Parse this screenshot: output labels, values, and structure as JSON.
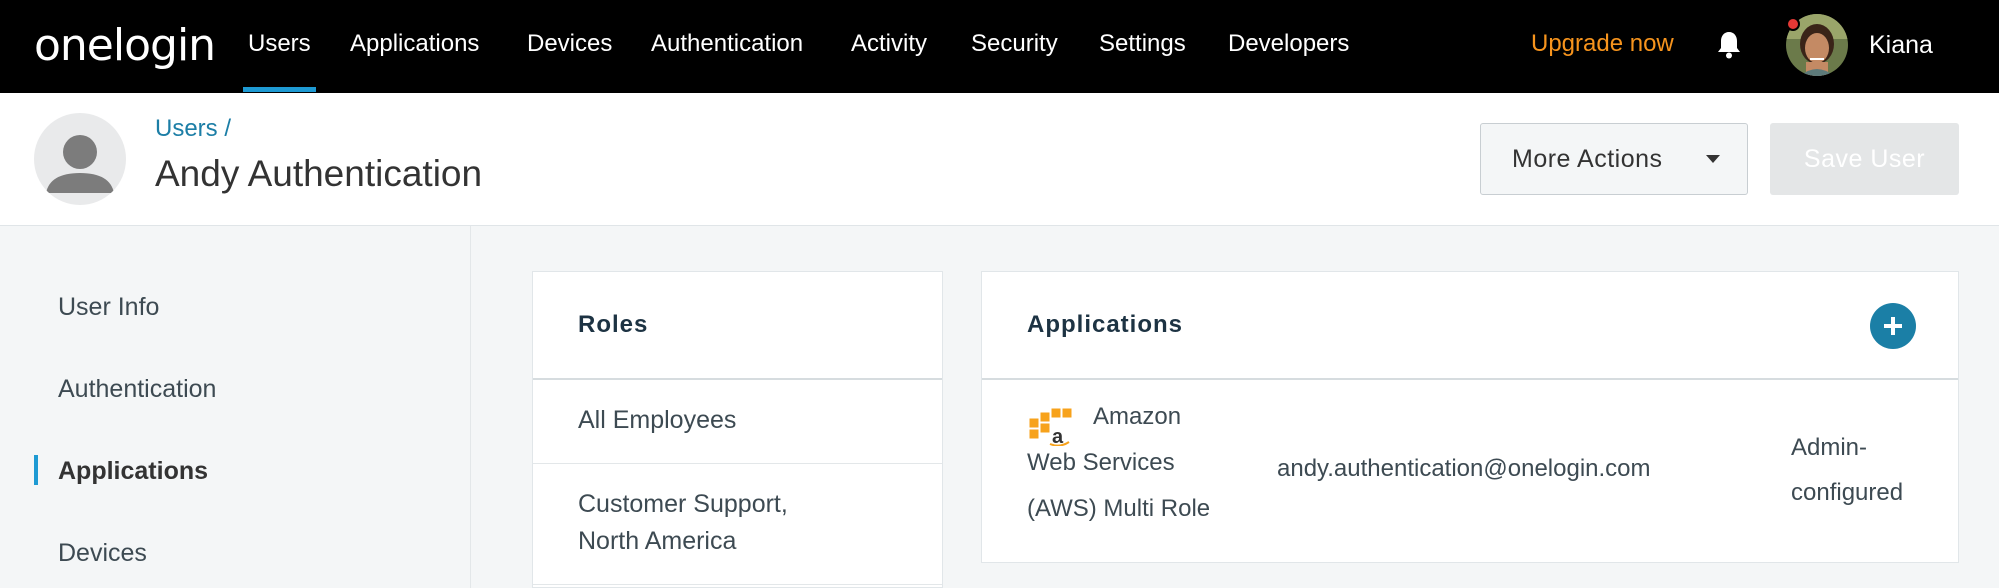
{
  "topnav": {
    "logo": "onelogin",
    "items": [
      {
        "label": "Users",
        "active": true
      },
      {
        "label": "Applications"
      },
      {
        "label": "Devices"
      },
      {
        "label": "Authentication"
      },
      {
        "label": "Activity"
      },
      {
        "label": "Security"
      },
      {
        "label": "Settings"
      },
      {
        "label": "Developers"
      }
    ],
    "upgrade_label": "Upgrade now",
    "username": "Kiana"
  },
  "header": {
    "breadcrumb": "Users /",
    "title": "Andy Authentication",
    "more_actions_label": "More Actions",
    "save_label": "Save User"
  },
  "sidebar": {
    "items": [
      {
        "label": "User Info"
      },
      {
        "label": "Authentication"
      },
      {
        "label": "Applications",
        "active": true
      },
      {
        "label": "Devices"
      }
    ]
  },
  "roles": {
    "title": "Roles",
    "items": [
      "All Employees",
      "Customer Support,",
      "North America"
    ]
  },
  "applications": {
    "title": "Applications",
    "rows": [
      {
        "name_line1": "Amazon",
        "name_line2": "Web Services",
        "name_line3": "(AWS) Multi Role",
        "email": "andy.authentication@onelogin.com",
        "config_line1": "Admin-",
        "config_line2": "configured"
      }
    ]
  },
  "colors": {
    "accent": "#1e9ad3",
    "upgrade": "#f7941d",
    "link": "#1c7ea6",
    "add_button": "#1b7fa6"
  }
}
